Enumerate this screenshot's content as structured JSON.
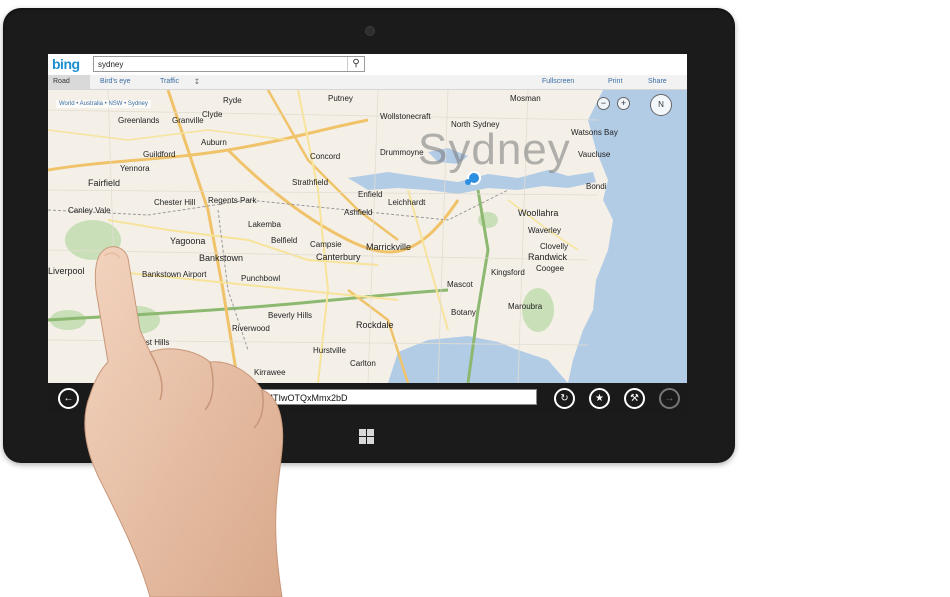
{
  "app": {
    "logo": "bing",
    "search_value": "sydney",
    "search_icon": "search-icon"
  },
  "toolbar": {
    "road": "Road",
    "birds_eye": "Bird's eye",
    "traffic": "Traffic",
    "fullscreen": "Fullscreen",
    "print": "Print",
    "share": "Share"
  },
  "map": {
    "breadcrumb": "World • Australia • NSW • Sydney",
    "big_label": "Sydney",
    "zoom_out": "−",
    "zoom_in": "+",
    "compass": "N",
    "places": [
      "Mosman",
      "Putney",
      "Ryde",
      "North Sydney",
      "Wollstonecraft",
      "Watsons Bay",
      "Vaucluse",
      "Auburn",
      "Greenlands",
      "Granville",
      "Clyde",
      "Concord",
      "Drummoyne",
      "Guildford",
      "Yennora",
      "Fairfield",
      "Chester Hill",
      "Regents Park",
      "Strathfield",
      "Ashfield",
      "Leichhardt",
      "Woollahra",
      "Waverley",
      "Bondi",
      "Canley Vale",
      "Yagoona",
      "Bankstown",
      "Belfield",
      "Campsie",
      "Canterbury",
      "Marrickville",
      "Clovelly",
      "Randwick",
      "Coogee",
      "Kingsford",
      "Liverpool",
      "Punchbowl",
      "Mascot",
      "Maroubra",
      "Beverly Hills",
      "Riverwood",
      "Rockdale",
      "Botany",
      "East Hills",
      "Hurstville",
      "Carlton",
      "Kirrawee",
      "Lakemba",
      "Bankstown Airport",
      "Enfield"
    ]
  },
  "appbar": {
    "back_icon": "back-arrow-icon",
    "url": "RM=Z9LH2#Y3A9NDcuNjgwNTAwfi0xMjIuMTIwOTQxMmx2bD",
    "refresh_icon": "refresh-icon",
    "favorite_icon": "star-icon",
    "tools_icon": "wrench-icon",
    "forward_icon": "forward-arrow-icon"
  },
  "device": {
    "windows_button": "windows-logo-icon"
  }
}
